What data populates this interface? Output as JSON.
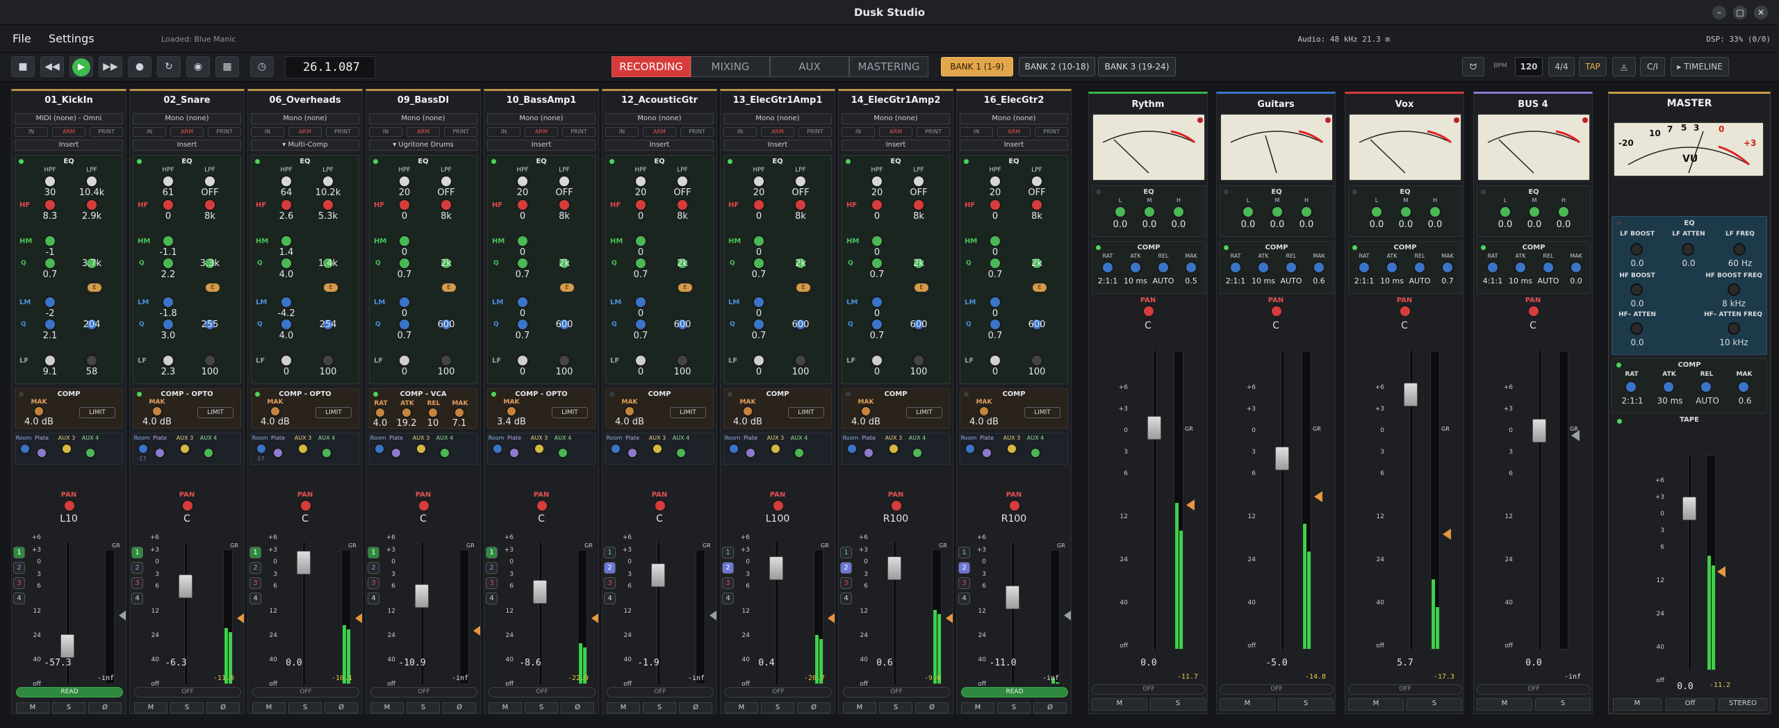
{
  "app": {
    "title": "Dusk Studio",
    "loaded": "Loaded: Blue Manic"
  },
  "menu": {
    "file": "File",
    "settings": "Settings"
  },
  "sysinfo": {
    "audio": "Audio: 48 kHz  21.3 m",
    "dsp": "DSP: 33% (0/0)"
  },
  "transport": {
    "timecode": "26.1.087"
  },
  "tabs": [
    "RECORDING",
    "MIXING",
    "AUX",
    "MASTERING"
  ],
  "banks": [
    "BANK 1  (1-9)",
    "BANK 2  (10-18)",
    "BANK 3  (19-24)"
  ],
  "tempo": {
    "bpm_label": "BPM",
    "bpm": "120",
    "meter": "4/4",
    "tap": "TAP",
    "cl": "C/I",
    "timeline": "▸ TIMELINE"
  },
  "strip_labels": {
    "in": "IN",
    "arm": "ARM",
    "print": "PRINT",
    "eq": "EQ",
    "hpf": "HPF",
    "lpf": "LPF",
    "hf": "HF",
    "hm": "HM",
    "q": "Q",
    "lm": "LM",
    "lf": "LF",
    "e": "E",
    "mak": "MAK",
    "limit": "LIMIT",
    "rat": "RAT",
    "atk": "ATK",
    "rel": "REL",
    "room": "Room",
    "plate": "Plate",
    "aux3": "AUX 3",
    "aux4": "AUX 4",
    "pan": "PAN",
    "gr": "GR",
    "m": "M",
    "s": "S",
    "phase": "Ø",
    "off": "OFF",
    "read": "READ"
  },
  "scale": [
    "+6",
    "+3",
    "0",
    "3",
    "6",
    "12",
    "24",
    "40",
    "off"
  ],
  "strips": [
    {
      "name": "01_KickIn",
      "input": "MIDI (none) - Omni",
      "insert": "Insert",
      "hpf": "30",
      "lpf": "10.4k",
      "hf": "8.3",
      "hf2": "2.9k",
      "hm": "-1",
      "hmq": "0.7",
      "hmf": "3.7k",
      "lm": "-2",
      "lmq": "2.1",
      "lmf": "204",
      "lf": "9.1",
      "lff": "58",
      "comp": "COMP",
      "mak": "4.0 dB",
      "pan": "L10",
      "db": "-57.3",
      "gr": "-inf",
      "mode": "READ"
    },
    {
      "name": "02_Snare",
      "input": "Mono (none)",
      "insert": "Insert",
      "hpf": "61",
      "lpf": "OFF",
      "hf": "0",
      "hf2": "8k",
      "hm": "-1.1",
      "hmq": "2.2",
      "hmf": "3.3k",
      "lm": "-1.8",
      "lmq": "3.0",
      "lmf": "255",
      "lf": "2.3",
      "lff": "100",
      "comp": "COMP - OPTO",
      "mak": "4.0 dB",
      "pan": "C",
      "db": "-6.3",
      "gr": "-11.9",
      "mode": "OFF",
      "sends": "-17"
    },
    {
      "name": "06_Overheads",
      "input": "Mono (none)",
      "insert": "▾ Multi-Comp",
      "hpf": "64",
      "lpf": "10.2k",
      "hf": "2.6",
      "hf2": "5.3k",
      "hm": "1.4",
      "hmq": "4.0",
      "hmf": "1.4k",
      "lm": "-4.2",
      "lmq": "4.0",
      "lmf": "254",
      "lf": "0",
      "lff": "100",
      "comp": "COMP - OPTO",
      "mak": "4.0 dB",
      "pan": "C",
      "db": "0.0",
      "gr": "-10.1",
      "mode": "OFF",
      "sends": "-17"
    },
    {
      "name": "09_BassDI",
      "input": "Mono (none)",
      "insert": "▾ Ugritone Drums",
      "hpf": "20",
      "lpf": "OFF",
      "hf": "0",
      "hf2": "8k",
      "hm": "0",
      "hmq": "0.7",
      "hmf": "2k",
      "lm": "0",
      "lmq": "0.7",
      "lmf": "600",
      "lf": "0",
      "lff": "100",
      "comp": "COMP - VCA",
      "rat": "4.0",
      "atk": "19.2",
      "rel": "10",
      "mak": "7.1",
      "pan": "C",
      "db": "-10.9",
      "gr": "-inf",
      "mode": "OFF"
    },
    {
      "name": "10_BassAmp1",
      "input": "Mono (none)",
      "insert": "Insert",
      "hpf": "20",
      "lpf": "OFF",
      "hf": "0",
      "hf2": "8k",
      "hm": "0",
      "hmq": "0.7",
      "hmf": "2k",
      "lm": "0",
      "lmq": "0.7",
      "lmf": "600",
      "lf": "0",
      "lff": "100",
      "comp": "COMP - OPTO",
      "mak": "3.4 dB",
      "pan": "C",
      "db": "-8.6",
      "gr": "-22.9",
      "mode": "OFF"
    },
    {
      "name": "12_AcousticGtr",
      "input": "Mono (none)",
      "insert": "Insert",
      "hpf": "20",
      "lpf": "OFF",
      "hf": "0",
      "hf2": "8k",
      "hm": "0",
      "hmq": "0.7",
      "hmf": "2k",
      "lm": "0",
      "lmq": "0.7",
      "lmf": "600",
      "lf": "0",
      "lff": "100",
      "comp": "COMP",
      "mak": "4.0 dB",
      "pan": "C",
      "db": "-1.9",
      "gr": "-inf",
      "mode": "OFF"
    },
    {
      "name": "13_ElecGtr1Amp1",
      "input": "Mono (none)",
      "insert": "Insert",
      "hpf": "20",
      "lpf": "OFF",
      "hf": "0",
      "hf2": "8k",
      "hm": "0",
      "hmq": "0.7",
      "hmf": "2k",
      "lm": "0",
      "lmq": "0.7",
      "lmf": "600",
      "lf": "0",
      "lff": "100",
      "comp": "COMP",
      "mak": "4.0 dB",
      "pan": "L100",
      "db": "0.4",
      "gr": "-20.7",
      "mode": "OFF"
    },
    {
      "name": "14_ElecGtr1Amp2",
      "input": "Mono (none)",
      "insert": "Insert",
      "hpf": "20",
      "lpf": "OFF",
      "hf": "0",
      "hf2": "8k",
      "hm": "0",
      "hmq": "0.7",
      "hmf": "2k",
      "lm": "0",
      "lmq": "0.7",
      "lmf": "600",
      "lf": "0",
      "lff": "100",
      "comp": "COMP",
      "mak": "4.0 dB",
      "pan": "R100",
      "db": "0.6",
      "gr": "-9.6",
      "mode": "OFF"
    },
    {
      "name": "16_ElecGtr2",
      "input": "Mono (none)",
      "insert": "Insert",
      "hpf": "20",
      "lpf": "OFF",
      "hf": "0",
      "hf2": "8k",
      "hm": "0",
      "hmq": "0.7",
      "hmf": "2k",
      "lm": "0",
      "lmq": "0.7",
      "lmf": "600",
      "lf": "0",
      "lff": "100",
      "comp": "COMP",
      "mak": "4.0 dB",
      "pan": "R100",
      "db": "-11.0",
      "gr": "-inf",
      "mode": "READ"
    }
  ],
  "bus_labels": {
    "eq": "EQ",
    "l": "L",
    "m": "M",
    "h": "H",
    "comp": "COMP",
    "rat": "RAT",
    "atk": "ATK",
    "rel": "REL",
    "mak": "MAK",
    "pan": "PAN",
    "gr": "GR",
    "off": "OFF",
    "m_btn": "M",
    "s_btn": "S"
  },
  "buses": [
    {
      "name": "Rythm",
      "l": "0.0",
      "m": "0.0",
      "h": "0.0",
      "rat": "2:1:1",
      "atk": "10 ms",
      "rel": "AUTO",
      "mak": "0.5",
      "pan": "C",
      "db": "0.0",
      "gr": "-11.7"
    },
    {
      "name": "Guitars",
      "l": "0.0",
      "m": "0.0",
      "h": "0.0",
      "rat": "2:1:1",
      "atk": "10 ms",
      "rel": "AUTO",
      "mak": "0.6",
      "pan": "C",
      "db": "-5.0",
      "gr": "-14.8"
    },
    {
      "name": "Vox",
      "l": "0.0",
      "m": "0.0",
      "h": "0.0",
      "rat": "2:1:1",
      "atk": "10 ms",
      "rel": "AUTO",
      "mak": "0.7",
      "pan": "C",
      "db": "5.7",
      "gr": "-17.3"
    },
    {
      "name": "BUS 4",
      "l": "0.0",
      "m": "0.0",
      "h": "0.0",
      "rat": "4:1:1",
      "atk": "10 ms",
      "rel": "AUTO",
      "mak": "0.0",
      "pan": "C",
      "db": "0.0",
      "gr": "-inf"
    }
  ],
  "master": {
    "title": "MASTER",
    "vu": "VU",
    "vu_scale": [
      "-20",
      "10",
      "7",
      "5",
      "3",
      "0",
      "+3"
    ],
    "eq": "EQ",
    "lf_boost": "LF BOOST",
    "lf_atten": "LF ATTEN",
    "lf_freq": "LF FREQ",
    "lf_boost_v": "0.0",
    "lf_atten_v": "0.0",
    "lf_freq_v": "60 Hz",
    "hf_boost": "HF BOOST",
    "hf_boost_freq": "HF BOOST FREQ",
    "hf_boost_v": "0.0",
    "hf_boost_freq_v": "8 kHz",
    "hf_atten": "HF– ATTEN",
    "hf_atten_freq": "HF– ATTEN FREQ",
    "hf_atten_v": "0.0",
    "hf_atten_freq_v": "10 kHz",
    "comp": "COMP",
    "rat": "RAT",
    "atk": "ATK",
    "rel": "REL",
    "mak": "MAK",
    "rat_v": "2:1:1",
    "atk_v": "30 ms",
    "rel_v": "AUTO",
    "mak_v": "0.6",
    "tape": "TAPE",
    "db": "0.0",
    "gr": "-11.2",
    "m": "M",
    "off": "Off",
    "stereo": "STEREO"
  }
}
